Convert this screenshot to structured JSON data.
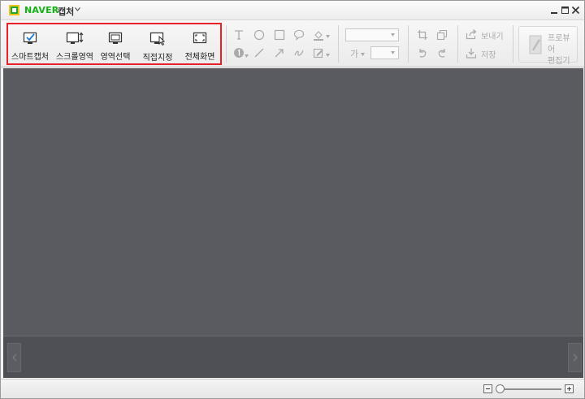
{
  "window": {
    "brand": "NAVER",
    "app_name": "캡처"
  },
  "capture_tools": [
    {
      "id": "smart",
      "label": "스마트캡처",
      "icon": "smart-capture-icon"
    },
    {
      "id": "scroll",
      "label": "스크롤영역",
      "icon": "scroll-area-icon"
    },
    {
      "id": "region",
      "label": "영역선택",
      "icon": "region-select-icon"
    },
    {
      "id": "direct",
      "label": "직접지정",
      "icon": "direct-select-icon"
    },
    {
      "id": "fullscreen",
      "label": "전체화면",
      "icon": "fullscreen-icon"
    }
  ],
  "text_controls": {
    "font_indicator": "가"
  },
  "actions": {
    "send_label": "보내기",
    "save_label": "저장"
  },
  "proview": {
    "line1": "프로뷰어",
    "line2": "편집기"
  },
  "colors": {
    "highlight_border": "#e8202a",
    "naver_green": "#12b312",
    "canvas_bg": "#595b60"
  }
}
